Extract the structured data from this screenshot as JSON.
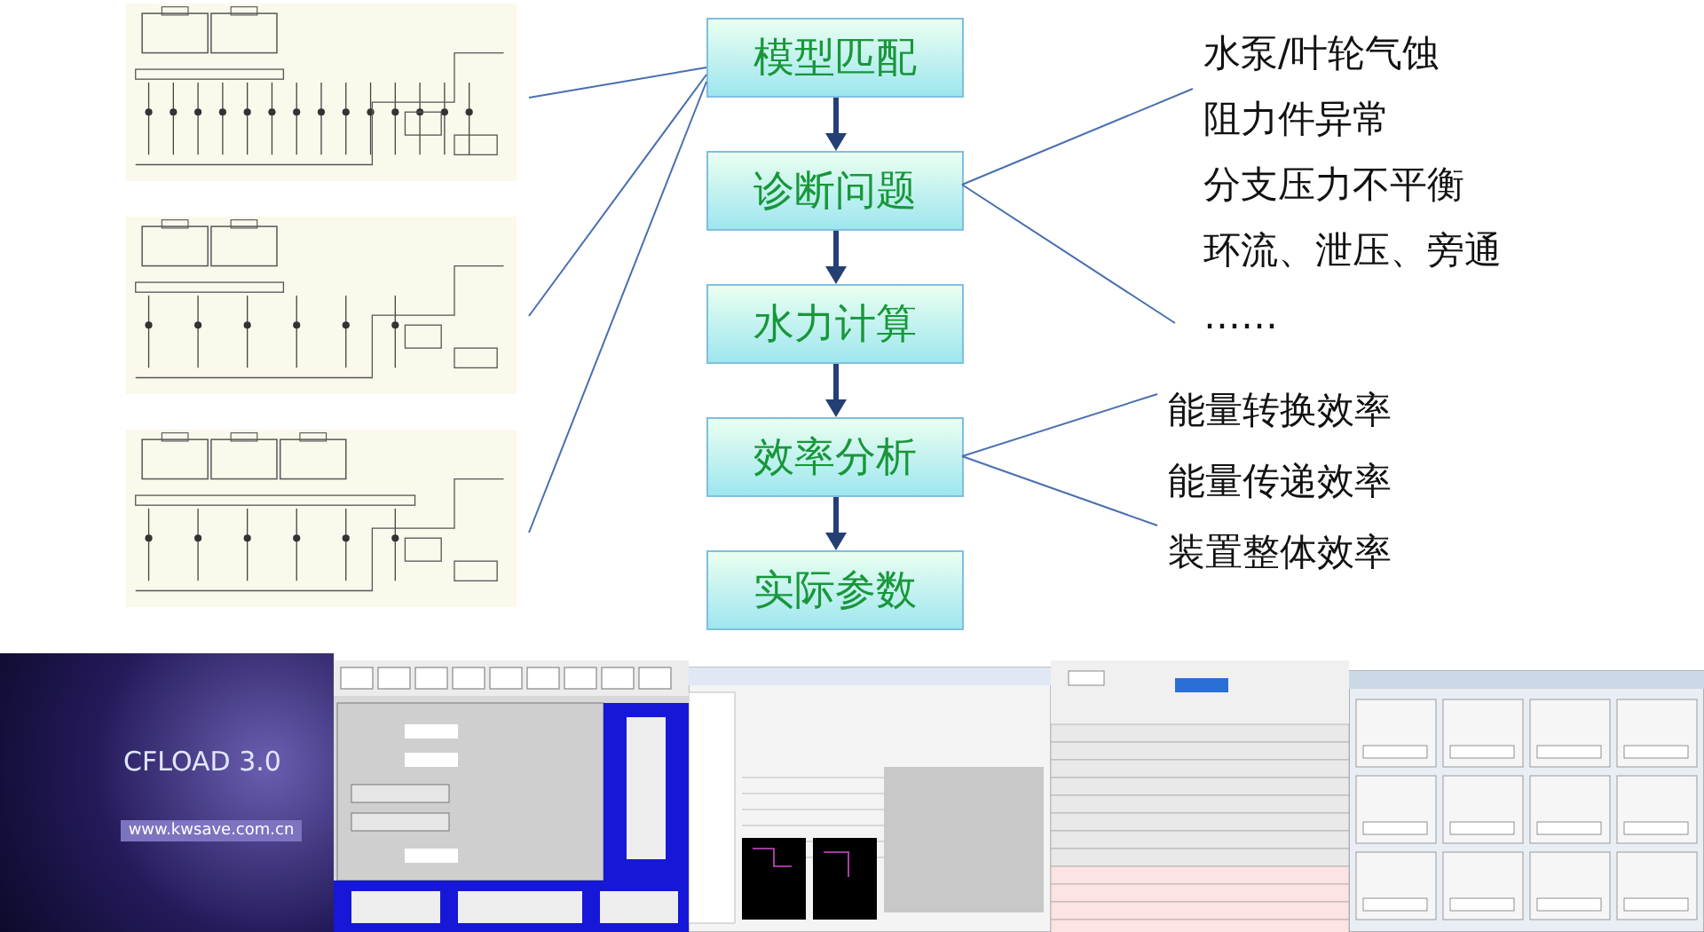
{
  "flow_steps": [
    {
      "label": "模型匹配"
    },
    {
      "label": "诊断问题"
    },
    {
      "label": "水力计算"
    },
    {
      "label": "效率分析"
    },
    {
      "label": "实际参数"
    }
  ],
  "problems": [
    "水泵/叶轮气蚀",
    "阻力件异常",
    "分支压力不平衡",
    "环流、泄压、旁通",
    "……"
  ],
  "efficiencies": [
    "能量转换效率",
    "能量传递效率",
    "装置整体效率"
  ],
  "splash": {
    "title": "CFLOAD 3.0",
    "url": "www.kwsave.com.cn"
  }
}
